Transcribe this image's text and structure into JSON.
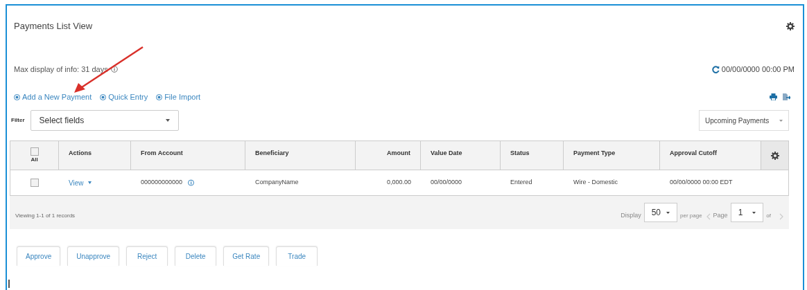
{
  "title": "Payments List View",
  "max_display": "Max display of info: 31 days",
  "last_refresh": "00/00/0000 00:00 PM",
  "actions": [
    "Add a New Payment",
    "Quick Entry",
    "File Import"
  ],
  "filter": {
    "label": "Filter",
    "placeholder": "Select fields"
  },
  "view_select": {
    "value": "Upcoming Payments"
  },
  "table": {
    "select_all": {
      "label": "All",
      "checked": false
    },
    "columns": [
      "Actions",
      "From Account",
      "Beneficiary",
      "Amount",
      "Value Date",
      "Status",
      "Payment Type",
      "Approval Cutoff"
    ],
    "rows": [
      {
        "checked": false,
        "action": "View",
        "from_account": "000000000000",
        "beneficiary": "CompanyName",
        "amount": "0,000.00",
        "value_date": "00/00/0000",
        "status": "Entered",
        "payment_type": "Wire - Domestic",
        "approval_cutoff": "00/00/0000 00:00 EDT"
      }
    ]
  },
  "footer": {
    "records": "Viewing 1-1 of 1 records",
    "display_label": "Display",
    "page_size": "50",
    "per_page": "per page",
    "page_label": "Page",
    "page": "1",
    "of_label": "of"
  },
  "buttons": [
    "Approve",
    "Unapprove",
    "Reject",
    "Delete",
    "Get Rate",
    "Trade"
  ]
}
